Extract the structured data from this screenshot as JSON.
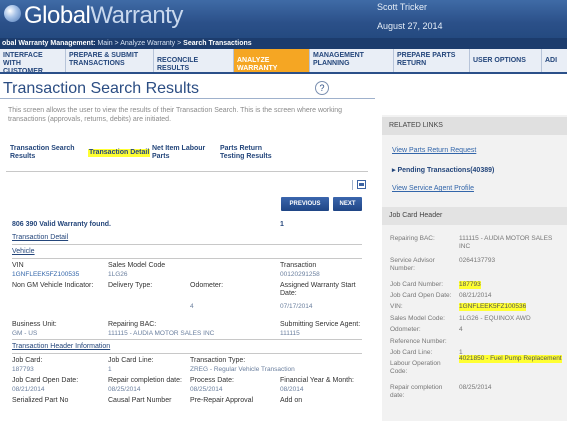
{
  "app": {
    "logo_prefix": "Global",
    "logo_suffix": "Warranty",
    "user_name": "Scott Tricker",
    "date": "August 27, 2014"
  },
  "breadcrumb": {
    "prefix": "obal Warranty Management:",
    "trail": "Main > Analyze Warranty >",
    "current": "Search Transactions"
  },
  "nav": {
    "tabs": [
      "INTERFACE WITH CUSTOMER",
      "PREPARE & SUBMIT TRANSACTIONS",
      "RECONCILE RESULTS",
      "ANALYZE WARRANTY",
      "MANAGEMENT PLANNING",
      "PREPARE PARTS RETURN",
      "USER OPTIONS",
      "ADI"
    ],
    "active_color": "#f5a623"
  },
  "page": {
    "title": "Transaction Search Results",
    "help_glyph": "?",
    "intro": "This screen allows the user to view the results of their Transaction Search. This is the screen where working transactions (approvals, returns, debits) are initiated.",
    "subtabs": [
      "Transaction Search Results",
      "Transaction Detail",
      "Net Item Labour Parts",
      "Parts Return Testing Results"
    ],
    "buttons": {
      "previous": "PREVIOUS",
      "next": "NEXT"
    },
    "found_text": "806 390 Valid Warranty found.",
    "record_index": "1"
  },
  "detail": {
    "section_transaction": "Transaction Detail",
    "section_vehicle": "Vehicle",
    "vin_label": "VIN",
    "vin_value": "1GNFLEEK5FZ100535",
    "smc_label": "Sales Model Code",
    "smc_value": "1LG26",
    "transaction_label": "Transaction",
    "transaction_value": "00120291258",
    "nongm_label": "Non GM Vehicle Indicator:",
    "delivery_label": "Delivery Type:",
    "odometer_label": "Odometer:",
    "odometer_value": "4",
    "assigned_label": "Assigned Warranty Start Date:",
    "assigned_value": "07/17/2014",
    "bu_label": "Business Unit:",
    "bu_value": "GM - US",
    "rbac_label": "Repairing BAC:",
    "rbac_value": "111115 - AUDIA MOTOR SALES INC",
    "ssa_label": "Submitting Service Agent:",
    "ssa_value": "111115",
    "section_header": "Transaction Header Information",
    "jobcard_label": "Job Card:",
    "jobcard_value": "187793",
    "jobline_label": "Job Card Line:",
    "jobline_value": "1",
    "ttype_label": "Transaction Type:",
    "ttype_value": "ZREG - Regular Vehicle Transaction",
    "jcodate_label": "Job Card Open Date:",
    "jcodate_value": "08/21/2014",
    "rcdate_label": "Repair completion date:",
    "rcdate_value": "08/25/2014",
    "pdate_label": "Process Date:",
    "pdate_value": "08/25/2014",
    "fy_label": "Financial Year & Month:",
    "fy_value": "08/2014",
    "cut1_label": "Serialized Part No",
    "cut2_label": "Causal Part Number",
    "cut3_label": "Pre-Repair Approval",
    "cut4_label": "Add on"
  },
  "right": {
    "related_links": "RELATED LINKS",
    "link1": "View Parts Return Request",
    "link2": "Pending Transactions(40389)",
    "link3": "View Service Agent Profile",
    "jc_header": "Job Card Header",
    "rows": [
      {
        "label": "Repairing BAC:",
        "value": "111115 - AUDIA MOTOR SALES INC"
      },
      {
        "label": "Service Advisor Number:",
        "value": "0264137793"
      },
      {
        "label": "Job Card Number:",
        "value": "187793"
      },
      {
        "label": "Job Card Open Date:",
        "value": "08/21/2014"
      },
      {
        "label": "VIN:",
        "value": "1GNFLEEK5FZ100536"
      },
      {
        "label": "Sales Model Code:",
        "value": "1LG26  -  EQUINOX AWD"
      },
      {
        "label": "Odometer:",
        "value": "4"
      },
      {
        "label": "Reference Number:",
        "value": ""
      },
      {
        "label": "Job Card Line:",
        "value": "1"
      },
      {
        "label": "Labour Operation Code:",
        "value": "4021850 - Fuel Pump Replacement"
      },
      {
        "label": "Repair completion date:",
        "value": "08/25/2014"
      }
    ],
    "highlight_color": "#ffff33"
  }
}
